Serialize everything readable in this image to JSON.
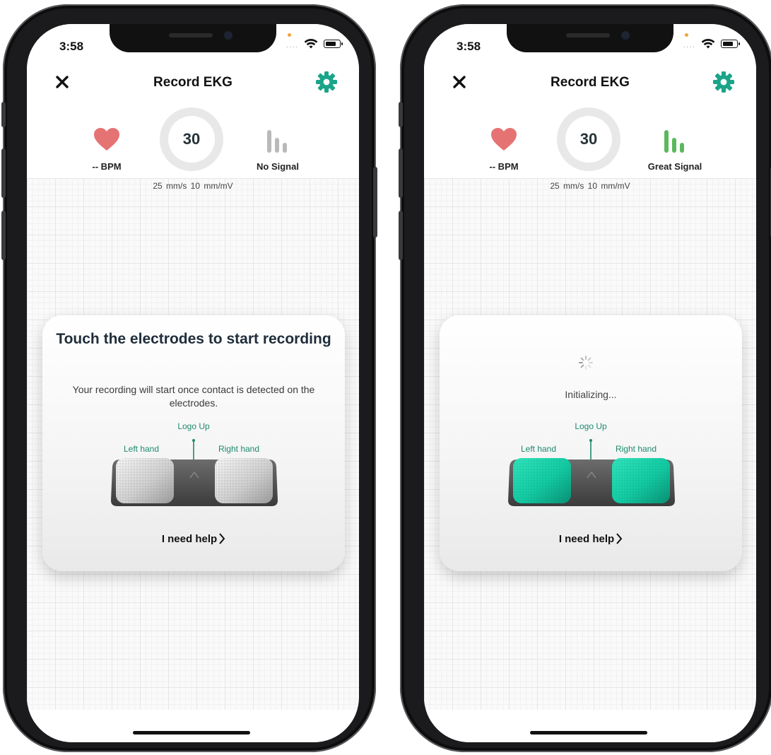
{
  "screens": [
    {
      "status": {
        "time": "3:58"
      },
      "header": {
        "title": "Record EKG"
      },
      "metrics": {
        "bpm_label": "-- BPM",
        "countdown": "30",
        "signal_label": "No Signal",
        "signal_state": "none"
      },
      "scale_label": "25 mm/s  10 mm/mV",
      "card": {
        "title": "Touch the electrodes to start recording",
        "description": "Your recording will start once contact is detected on the electrodes.",
        "logo_up_label": "Logo Up",
        "left_hand_label": "Left hand",
        "right_hand_label": "Right hand",
        "help_label": "I need help",
        "electrode_state": "inactive"
      }
    },
    {
      "status": {
        "time": "3:58"
      },
      "header": {
        "title": "Record EKG"
      },
      "metrics": {
        "bpm_label": "-- BPM",
        "countdown": "30",
        "signal_label": "Great Signal",
        "signal_state": "great"
      },
      "scale_label": "25 mm/s  10 mm/mV",
      "card": {
        "status_text": "Initializing...",
        "logo_up_label": "Logo Up",
        "left_hand_label": "Left hand",
        "right_hand_label": "Right hand",
        "help_label": "I need help",
        "electrode_state": "active"
      }
    }
  ],
  "colors": {
    "accent_teal": "#1aa58a",
    "heart": "#e57373",
    "signal_great": "#5cb85c",
    "signal_none": "#b9b9b9",
    "electrode_active": "#12c9a1"
  }
}
